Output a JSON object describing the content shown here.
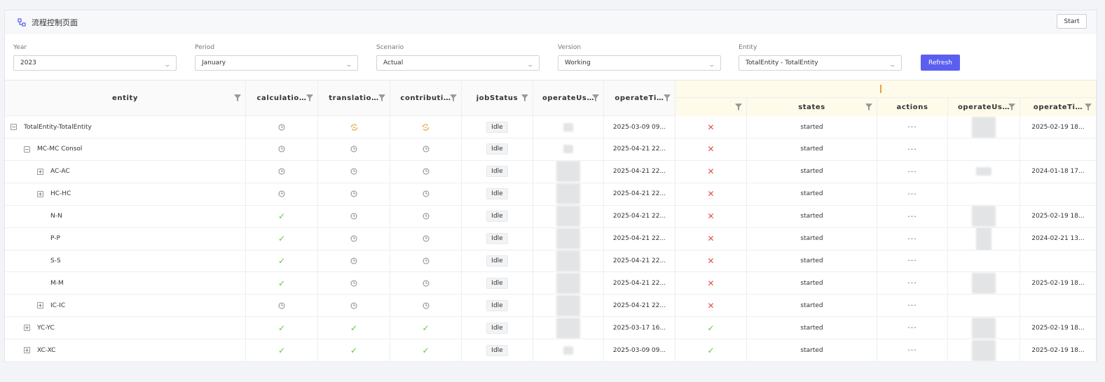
{
  "page": {
    "title": "流程控制页面",
    "start_label": "Start",
    "refresh_label": "Refresh"
  },
  "filters": [
    {
      "label": "Year",
      "value": "2023"
    },
    {
      "label": "Period",
      "value": "January"
    },
    {
      "label": "Scenario",
      "value": "Actual"
    },
    {
      "label": "Version",
      "value": "Working"
    },
    {
      "label": "Entity",
      "value": "TotalEntity - TotalEntity"
    }
  ],
  "columns": {
    "entity": "entity",
    "calculation": "calculatio…",
    "translation": "translatio…",
    "contribution": "contributi…",
    "jobStatus": "jobStatus",
    "operateUser": "operateUs…",
    "operateTime": "operateTi…",
    "states": "states",
    "actions": "actions",
    "operateUser2": "operateUs…",
    "operateTime2": "operateTi…"
  },
  "rows": [
    {
      "level": 0,
      "toggle": "−",
      "entity": "TotalEntity-TotalEntity",
      "calc": "pending",
      "trans": "warn",
      "contrib": "warn",
      "job": "Idle",
      "user_shape": "small",
      "time": "2025-03-09 09...",
      "flag": "x",
      "states": "started",
      "actions": "···",
      "user2_shape": "large",
      "time2": "2025-02-19 18..."
    },
    {
      "level": 1,
      "toggle": "−",
      "entity": "MC-MC Consol",
      "calc": "pending",
      "trans": "pending",
      "contrib": "pending",
      "job": "Idle",
      "user_shape": "small",
      "time": "2025-04-21 22...",
      "flag": "x",
      "states": "started",
      "actions": "···",
      "user2_shape": "none",
      "time2": ""
    },
    {
      "level": 2,
      "toggle": "+",
      "entity": "AC-AC",
      "calc": "pending",
      "trans": "pending",
      "contrib": "pending",
      "job": "Idle",
      "user_shape": "large",
      "time": "2025-04-21 22...",
      "flag": "x",
      "states": "started",
      "actions": "···",
      "user2_shape": "medium",
      "time2": "2024-01-18 17..."
    },
    {
      "level": 2,
      "toggle": "+",
      "entity": "HC-HC",
      "calc": "pending",
      "trans": "pending",
      "contrib": "pending",
      "job": "Idle",
      "user_shape": "large",
      "time": "2025-04-21 22...",
      "flag": "x",
      "states": "started",
      "actions": "···",
      "user2_shape": "none",
      "time2": ""
    },
    {
      "level": 2,
      "toggle": "",
      "entity": "N-N",
      "calc": "ok",
      "trans": "pending",
      "contrib": "pending",
      "job": "Idle",
      "user_shape": "large",
      "time": "2025-04-21 22...",
      "flag": "x",
      "states": "started",
      "actions": "···",
      "user2_shape": "large",
      "time2": "2025-02-19 18..."
    },
    {
      "level": 2,
      "toggle": "",
      "entity": "P-P",
      "calc": "ok",
      "trans": "pending",
      "contrib": "pending",
      "job": "Idle",
      "user_shape": "large",
      "time": "2025-04-21 22...",
      "flag": "x",
      "states": "started",
      "actions": "···",
      "user2_shape": "tall",
      "time2": "2024-02-21 13..."
    },
    {
      "level": 2,
      "toggle": "",
      "entity": "S-S",
      "calc": "ok",
      "trans": "pending",
      "contrib": "pending",
      "job": "Idle",
      "user_shape": "large",
      "time": "2025-04-21 22...",
      "flag": "x",
      "states": "started",
      "actions": "···",
      "user2_shape": "none",
      "time2": ""
    },
    {
      "level": 2,
      "toggle": "",
      "entity": "M-M",
      "calc": "ok",
      "trans": "pending",
      "contrib": "pending",
      "job": "Idle",
      "user_shape": "large",
      "time": "2025-04-21 22...",
      "flag": "x",
      "states": "started",
      "actions": "···",
      "user2_shape": "large",
      "time2": "2025-02-19 18..."
    },
    {
      "level": 2,
      "toggle": "+",
      "entity": "IC-IC",
      "calc": "pending",
      "trans": "pending",
      "contrib": "pending",
      "job": "Idle",
      "user_shape": "large",
      "time": "2025-04-21 22...",
      "flag": "x",
      "states": "started",
      "actions": "···",
      "user2_shape": "none",
      "time2": ""
    },
    {
      "level": 1,
      "toggle": "+",
      "entity": "YC-YC",
      "calc": "ok",
      "trans": "ok",
      "contrib": "ok",
      "job": "Idle",
      "user_shape": "large",
      "time": "2025-03-17 16...",
      "flag": "ok",
      "states": "started",
      "actions": "···",
      "user2_shape": "large",
      "time2": "2025-02-19 18..."
    },
    {
      "level": 1,
      "toggle": "+",
      "entity": "XC-XC",
      "calc": "ok",
      "trans": "ok",
      "contrib": "ok",
      "job": "Idle",
      "user_shape": "small",
      "time": "2025-03-09 09...",
      "flag": "ok",
      "states": "started",
      "actions": "···",
      "user2_shape": "large",
      "time2": "2025-02-19 18..."
    }
  ],
  "colors": {
    "accent": "#5b5ff0",
    "ok": "#67c23a",
    "error": "#e0524e",
    "warn": "#e6a23c"
  }
}
